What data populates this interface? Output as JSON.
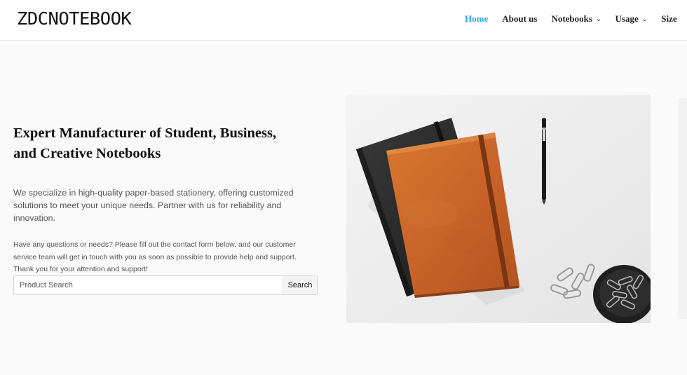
{
  "header": {
    "logo_text": "ZDCNOTEBOOK",
    "nav": [
      {
        "label": "Home",
        "active": true,
        "dropdown": false
      },
      {
        "label": "About us",
        "active": false,
        "dropdown": false
      },
      {
        "label": "Notebooks",
        "active": false,
        "dropdown": true
      },
      {
        "label": "Usage",
        "active": false,
        "dropdown": true
      },
      {
        "label": "Size",
        "active": false,
        "dropdown": false
      }
    ],
    "active_color": "#2ea3f2"
  },
  "hero": {
    "title_line1": "Expert Manufacturer of Student, Business,",
    "title_line2": "and Creative Notebooks",
    "desc_line1": "We specialize in high-quality paper-based stationery, offering customized",
    "desc_line2": "solutions to meet your unique needs. Partner with us for reliability and innovation.",
    "note_line1": "Have any questions or needs? Please fill out the contact form below, and our customer",
    "note_line2": "service team will get in touch with you as soon as possible to provide help and support.",
    "note_line3": "Thank you for your attention and support!"
  },
  "search": {
    "placeholder": "Product Search",
    "button_label": "Search"
  },
  "photo": {
    "subject": "notebooks-pen-paperclips",
    "icons": [
      "chevron-down-icon"
    ]
  }
}
